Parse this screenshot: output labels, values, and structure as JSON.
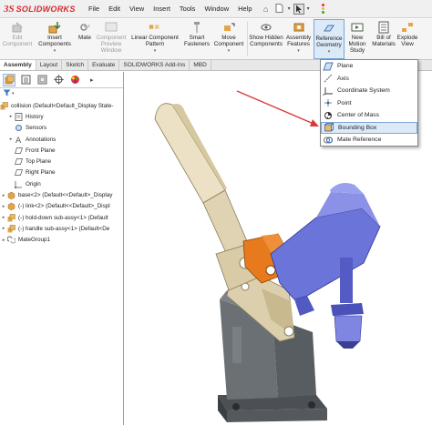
{
  "app": {
    "logo_prefix": "3S",
    "logo_name": "SOLIDWORKS"
  },
  "menu": [
    "File",
    "Edit",
    "View",
    "Insert",
    "Tools",
    "Window",
    "Help"
  ],
  "quick_access": {
    "home_icon": "home-icon",
    "new_icon": "new-document-icon",
    "select_icon": "select-arrow-icon"
  },
  "ribbon": {
    "edit_component": "Edit Component",
    "insert_components": "Insert Components",
    "mate": "Mate",
    "component_preview": "Component Preview Window",
    "linear_pattern": "Linear Component Pattern",
    "smart_fasteners": "Smart Fasteners",
    "move_component": "Move Component",
    "show_hidden": "Show Hidden Components",
    "assembly_features": "Assembly Features",
    "reference_geometry": "Reference Geometry",
    "new_motion_study": "New Motion Study",
    "bill_of_materials": "Bill of Materials",
    "exploded_view": "Explode View"
  },
  "tabs": [
    "Assembly",
    "Layout",
    "Sketch",
    "Evaluate",
    "SOLIDWORKS Add-Ins",
    "MBD"
  ],
  "tree": {
    "root": "collision (Default<Default_Display State-",
    "items": [
      {
        "label": "History",
        "icon": "history-icon"
      },
      {
        "label": "Sensors",
        "icon": "sensors-icon"
      },
      {
        "label": "Annotations",
        "icon": "annotations-icon"
      },
      {
        "label": "Front Plane",
        "icon": "plane-icon"
      },
      {
        "label": "Top Plane",
        "icon": "plane-icon"
      },
      {
        "label": "Right Plane",
        "icon": "plane-icon"
      },
      {
        "label": "Origin",
        "icon": "origin-icon"
      },
      {
        "label": "base<2> (Default<<Default>_Display",
        "icon": "part-icon"
      },
      {
        "label": "(-) link<2> (Default<<Default>_Displ",
        "icon": "part-icon"
      },
      {
        "label": "(-) hold-down sub-assy<1> (Default",
        "icon": "subassembly-icon"
      },
      {
        "label": "(-) handle sub-assy<1> (Default<De",
        "icon": "subassembly-icon"
      },
      {
        "label": "MateGroup1",
        "icon": "mate-group-icon"
      }
    ]
  },
  "reference_menu": {
    "items": [
      {
        "label": "Plane",
        "icon": "plane-icon"
      },
      {
        "label": "Axis",
        "icon": "axis-icon"
      },
      {
        "label": "Coordinate System",
        "icon": "coordinate-system-icon"
      },
      {
        "label": "Point",
        "icon": "point-icon"
      },
      {
        "label": "Center of Mass",
        "icon": "center-of-mass-icon"
      },
      {
        "label": "Bounding Box",
        "icon": "bounding-box-icon"
      },
      {
        "label": "Mate Reference",
        "icon": "mate-reference-icon"
      }
    ],
    "highlighted_index": 5
  },
  "colors": {
    "brand_red": "#d7282f",
    "handle_beige": "#e8dcc0",
    "slider_blue": "#6b74d9",
    "pivot_orange": "#e77a1c",
    "base_gray": "#5f6468",
    "annotation_arrow": "#d93a3a"
  }
}
